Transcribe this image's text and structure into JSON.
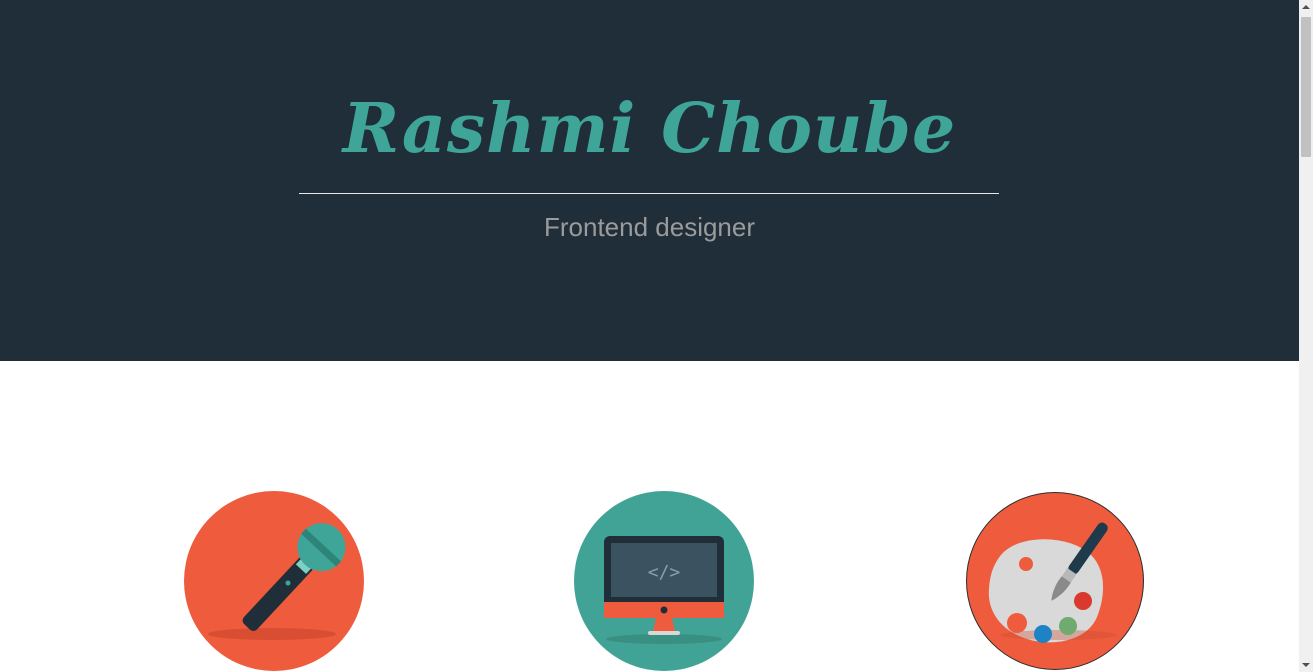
{
  "hero": {
    "title": "Rashmi Choube",
    "subtitle": "Frontend designer"
  },
  "skills": [
    {
      "icon": "microphone-icon"
    },
    {
      "icon": "monitor-code-icon",
      "code_glyph": "</>"
    },
    {
      "icon": "paint-palette-icon"
    }
  ],
  "colors": {
    "hero_background": "#1f2e38",
    "accent_teal": "#3fa598",
    "accent_orange": "#ef5c3d",
    "subtitle_gray": "#9b9b9b"
  }
}
